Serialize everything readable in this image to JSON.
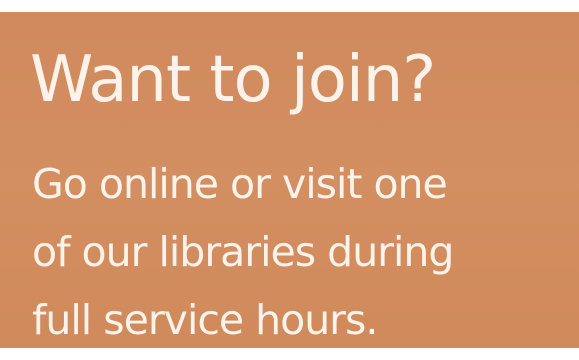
{
  "panel": {
    "background_color": "#d18c5e",
    "text_color": "#fdf3ea",
    "headline": "Want to join?",
    "body_lines": [
      "Go online or visit one",
      "of our libraries during",
      "full service hours."
    ]
  }
}
